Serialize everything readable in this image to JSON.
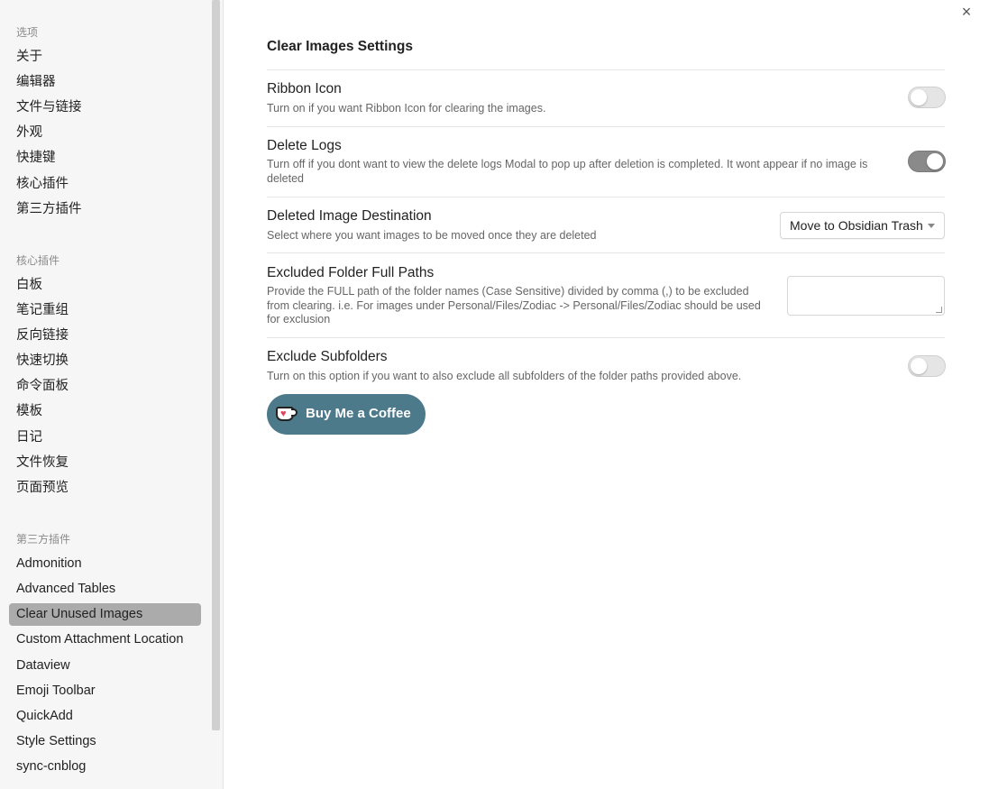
{
  "sidebar": {
    "section_options": "选项",
    "options": [
      "关于",
      "编辑器",
      "文件与链接",
      "外观",
      "快捷键",
      "核心插件",
      "第三方插件"
    ],
    "section_core": "核心插件",
    "core": [
      "白板",
      "笔记重组",
      "反向链接",
      "快速切换",
      "命令面板",
      "模板",
      "日记",
      "文件恢复",
      "页面预览"
    ],
    "section_third": "第三方插件",
    "third": [
      "Admonition",
      "Advanced Tables",
      "Clear Unused Images",
      "Custom Attachment Location",
      "Dataview",
      "Emoji Toolbar",
      "QuickAdd",
      "Style Settings",
      "sync-cnblog"
    ],
    "active_item": "Clear Unused Images"
  },
  "main": {
    "close_icon": "×",
    "title": "Clear Images Settings",
    "settings": [
      {
        "name": "Ribbon Icon",
        "desc": "Turn on if you want Ribbon Icon for clearing the images.",
        "control": "toggle",
        "enabled": false
      },
      {
        "name": "Delete Logs",
        "desc": "Turn off if you dont want to view the delete logs Modal to pop up after deletion is completed. It wont appear if no image is deleted",
        "control": "toggle",
        "enabled": true
      },
      {
        "name": "Deleted Image Destination",
        "desc": "Select where you want images to be moved once they are deleted",
        "control": "dropdown",
        "value": "Move to Obsidian Trash"
      },
      {
        "name": "Excluded Folder Full Paths",
        "desc": "Provide the FULL path of the folder names (Case Sensitive) divided by comma (,) to be excluded from clearing. i.e. For images under Personal/Files/Zodiac -> Personal/Files/Zodiac should be used for exclusion",
        "control": "textarea",
        "value": ""
      },
      {
        "name": "Exclude Subfolders",
        "desc": "Turn on this option if you want to also exclude all subfolders of the folder paths provided above.",
        "control": "toggle",
        "enabled": false
      }
    ],
    "coffee_label": "Buy Me a Coffee"
  },
  "colors": {
    "sidebar_bg": "#f6f6f6",
    "active_item_bg": "#ababab",
    "toggle_on": "#8a8a8a",
    "toggle_off": "#e5e5e5",
    "coffee_button": "#4d7a8a",
    "heart": "#e0455d"
  },
  "icons": [
    "close-icon",
    "chevron-down-icon",
    "coffee-cup-icon",
    "heart-icon"
  ]
}
